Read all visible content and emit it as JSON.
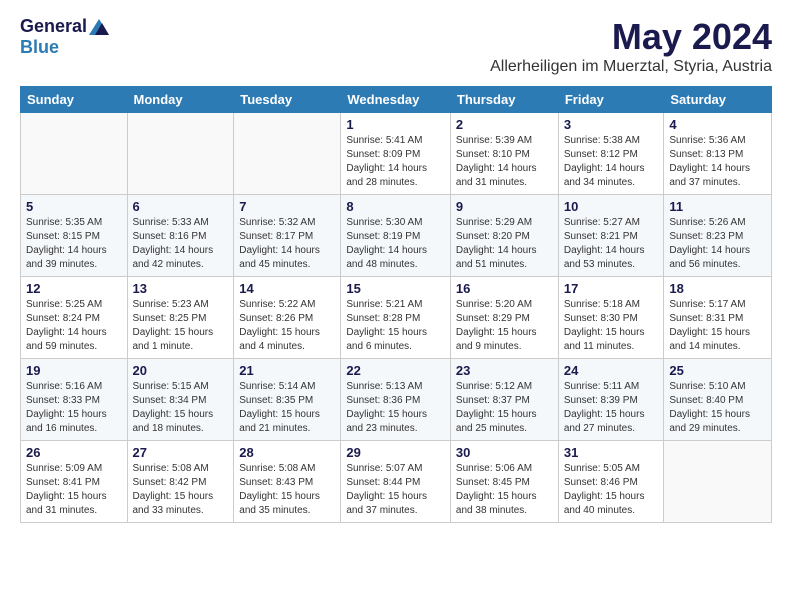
{
  "logo": {
    "general": "General",
    "blue": "Blue"
  },
  "title": "May 2024",
  "location": "Allerheiligen im Muerztal, Styria, Austria",
  "days_header": [
    "Sunday",
    "Monday",
    "Tuesday",
    "Wednesday",
    "Thursday",
    "Friday",
    "Saturday"
  ],
  "weeks": [
    [
      {
        "num": "",
        "info": ""
      },
      {
        "num": "",
        "info": ""
      },
      {
        "num": "",
        "info": ""
      },
      {
        "num": "1",
        "info": "Sunrise: 5:41 AM\nSunset: 8:09 PM\nDaylight: 14 hours\nand 28 minutes."
      },
      {
        "num": "2",
        "info": "Sunrise: 5:39 AM\nSunset: 8:10 PM\nDaylight: 14 hours\nand 31 minutes."
      },
      {
        "num": "3",
        "info": "Sunrise: 5:38 AM\nSunset: 8:12 PM\nDaylight: 14 hours\nand 34 minutes."
      },
      {
        "num": "4",
        "info": "Sunrise: 5:36 AM\nSunset: 8:13 PM\nDaylight: 14 hours\nand 37 minutes."
      }
    ],
    [
      {
        "num": "5",
        "info": "Sunrise: 5:35 AM\nSunset: 8:15 PM\nDaylight: 14 hours\nand 39 minutes."
      },
      {
        "num": "6",
        "info": "Sunrise: 5:33 AM\nSunset: 8:16 PM\nDaylight: 14 hours\nand 42 minutes."
      },
      {
        "num": "7",
        "info": "Sunrise: 5:32 AM\nSunset: 8:17 PM\nDaylight: 14 hours\nand 45 minutes."
      },
      {
        "num": "8",
        "info": "Sunrise: 5:30 AM\nSunset: 8:19 PM\nDaylight: 14 hours\nand 48 minutes."
      },
      {
        "num": "9",
        "info": "Sunrise: 5:29 AM\nSunset: 8:20 PM\nDaylight: 14 hours\nand 51 minutes."
      },
      {
        "num": "10",
        "info": "Sunrise: 5:27 AM\nSunset: 8:21 PM\nDaylight: 14 hours\nand 53 minutes."
      },
      {
        "num": "11",
        "info": "Sunrise: 5:26 AM\nSunset: 8:23 PM\nDaylight: 14 hours\nand 56 minutes."
      }
    ],
    [
      {
        "num": "12",
        "info": "Sunrise: 5:25 AM\nSunset: 8:24 PM\nDaylight: 14 hours\nand 59 minutes."
      },
      {
        "num": "13",
        "info": "Sunrise: 5:23 AM\nSunset: 8:25 PM\nDaylight: 15 hours\nand 1 minute."
      },
      {
        "num": "14",
        "info": "Sunrise: 5:22 AM\nSunset: 8:26 PM\nDaylight: 15 hours\nand 4 minutes."
      },
      {
        "num": "15",
        "info": "Sunrise: 5:21 AM\nSunset: 8:28 PM\nDaylight: 15 hours\nand 6 minutes."
      },
      {
        "num": "16",
        "info": "Sunrise: 5:20 AM\nSunset: 8:29 PM\nDaylight: 15 hours\nand 9 minutes."
      },
      {
        "num": "17",
        "info": "Sunrise: 5:18 AM\nSunset: 8:30 PM\nDaylight: 15 hours\nand 11 minutes."
      },
      {
        "num": "18",
        "info": "Sunrise: 5:17 AM\nSunset: 8:31 PM\nDaylight: 15 hours\nand 14 minutes."
      }
    ],
    [
      {
        "num": "19",
        "info": "Sunrise: 5:16 AM\nSunset: 8:33 PM\nDaylight: 15 hours\nand 16 minutes."
      },
      {
        "num": "20",
        "info": "Sunrise: 5:15 AM\nSunset: 8:34 PM\nDaylight: 15 hours\nand 18 minutes."
      },
      {
        "num": "21",
        "info": "Sunrise: 5:14 AM\nSunset: 8:35 PM\nDaylight: 15 hours\nand 21 minutes."
      },
      {
        "num": "22",
        "info": "Sunrise: 5:13 AM\nSunset: 8:36 PM\nDaylight: 15 hours\nand 23 minutes."
      },
      {
        "num": "23",
        "info": "Sunrise: 5:12 AM\nSunset: 8:37 PM\nDaylight: 15 hours\nand 25 minutes."
      },
      {
        "num": "24",
        "info": "Sunrise: 5:11 AM\nSunset: 8:39 PM\nDaylight: 15 hours\nand 27 minutes."
      },
      {
        "num": "25",
        "info": "Sunrise: 5:10 AM\nSunset: 8:40 PM\nDaylight: 15 hours\nand 29 minutes."
      }
    ],
    [
      {
        "num": "26",
        "info": "Sunrise: 5:09 AM\nSunset: 8:41 PM\nDaylight: 15 hours\nand 31 minutes."
      },
      {
        "num": "27",
        "info": "Sunrise: 5:08 AM\nSunset: 8:42 PM\nDaylight: 15 hours\nand 33 minutes."
      },
      {
        "num": "28",
        "info": "Sunrise: 5:08 AM\nSunset: 8:43 PM\nDaylight: 15 hours\nand 35 minutes."
      },
      {
        "num": "29",
        "info": "Sunrise: 5:07 AM\nSunset: 8:44 PM\nDaylight: 15 hours\nand 37 minutes."
      },
      {
        "num": "30",
        "info": "Sunrise: 5:06 AM\nSunset: 8:45 PM\nDaylight: 15 hours\nand 38 minutes."
      },
      {
        "num": "31",
        "info": "Sunrise: 5:05 AM\nSunset: 8:46 PM\nDaylight: 15 hours\nand 40 minutes."
      },
      {
        "num": "",
        "info": ""
      }
    ]
  ]
}
